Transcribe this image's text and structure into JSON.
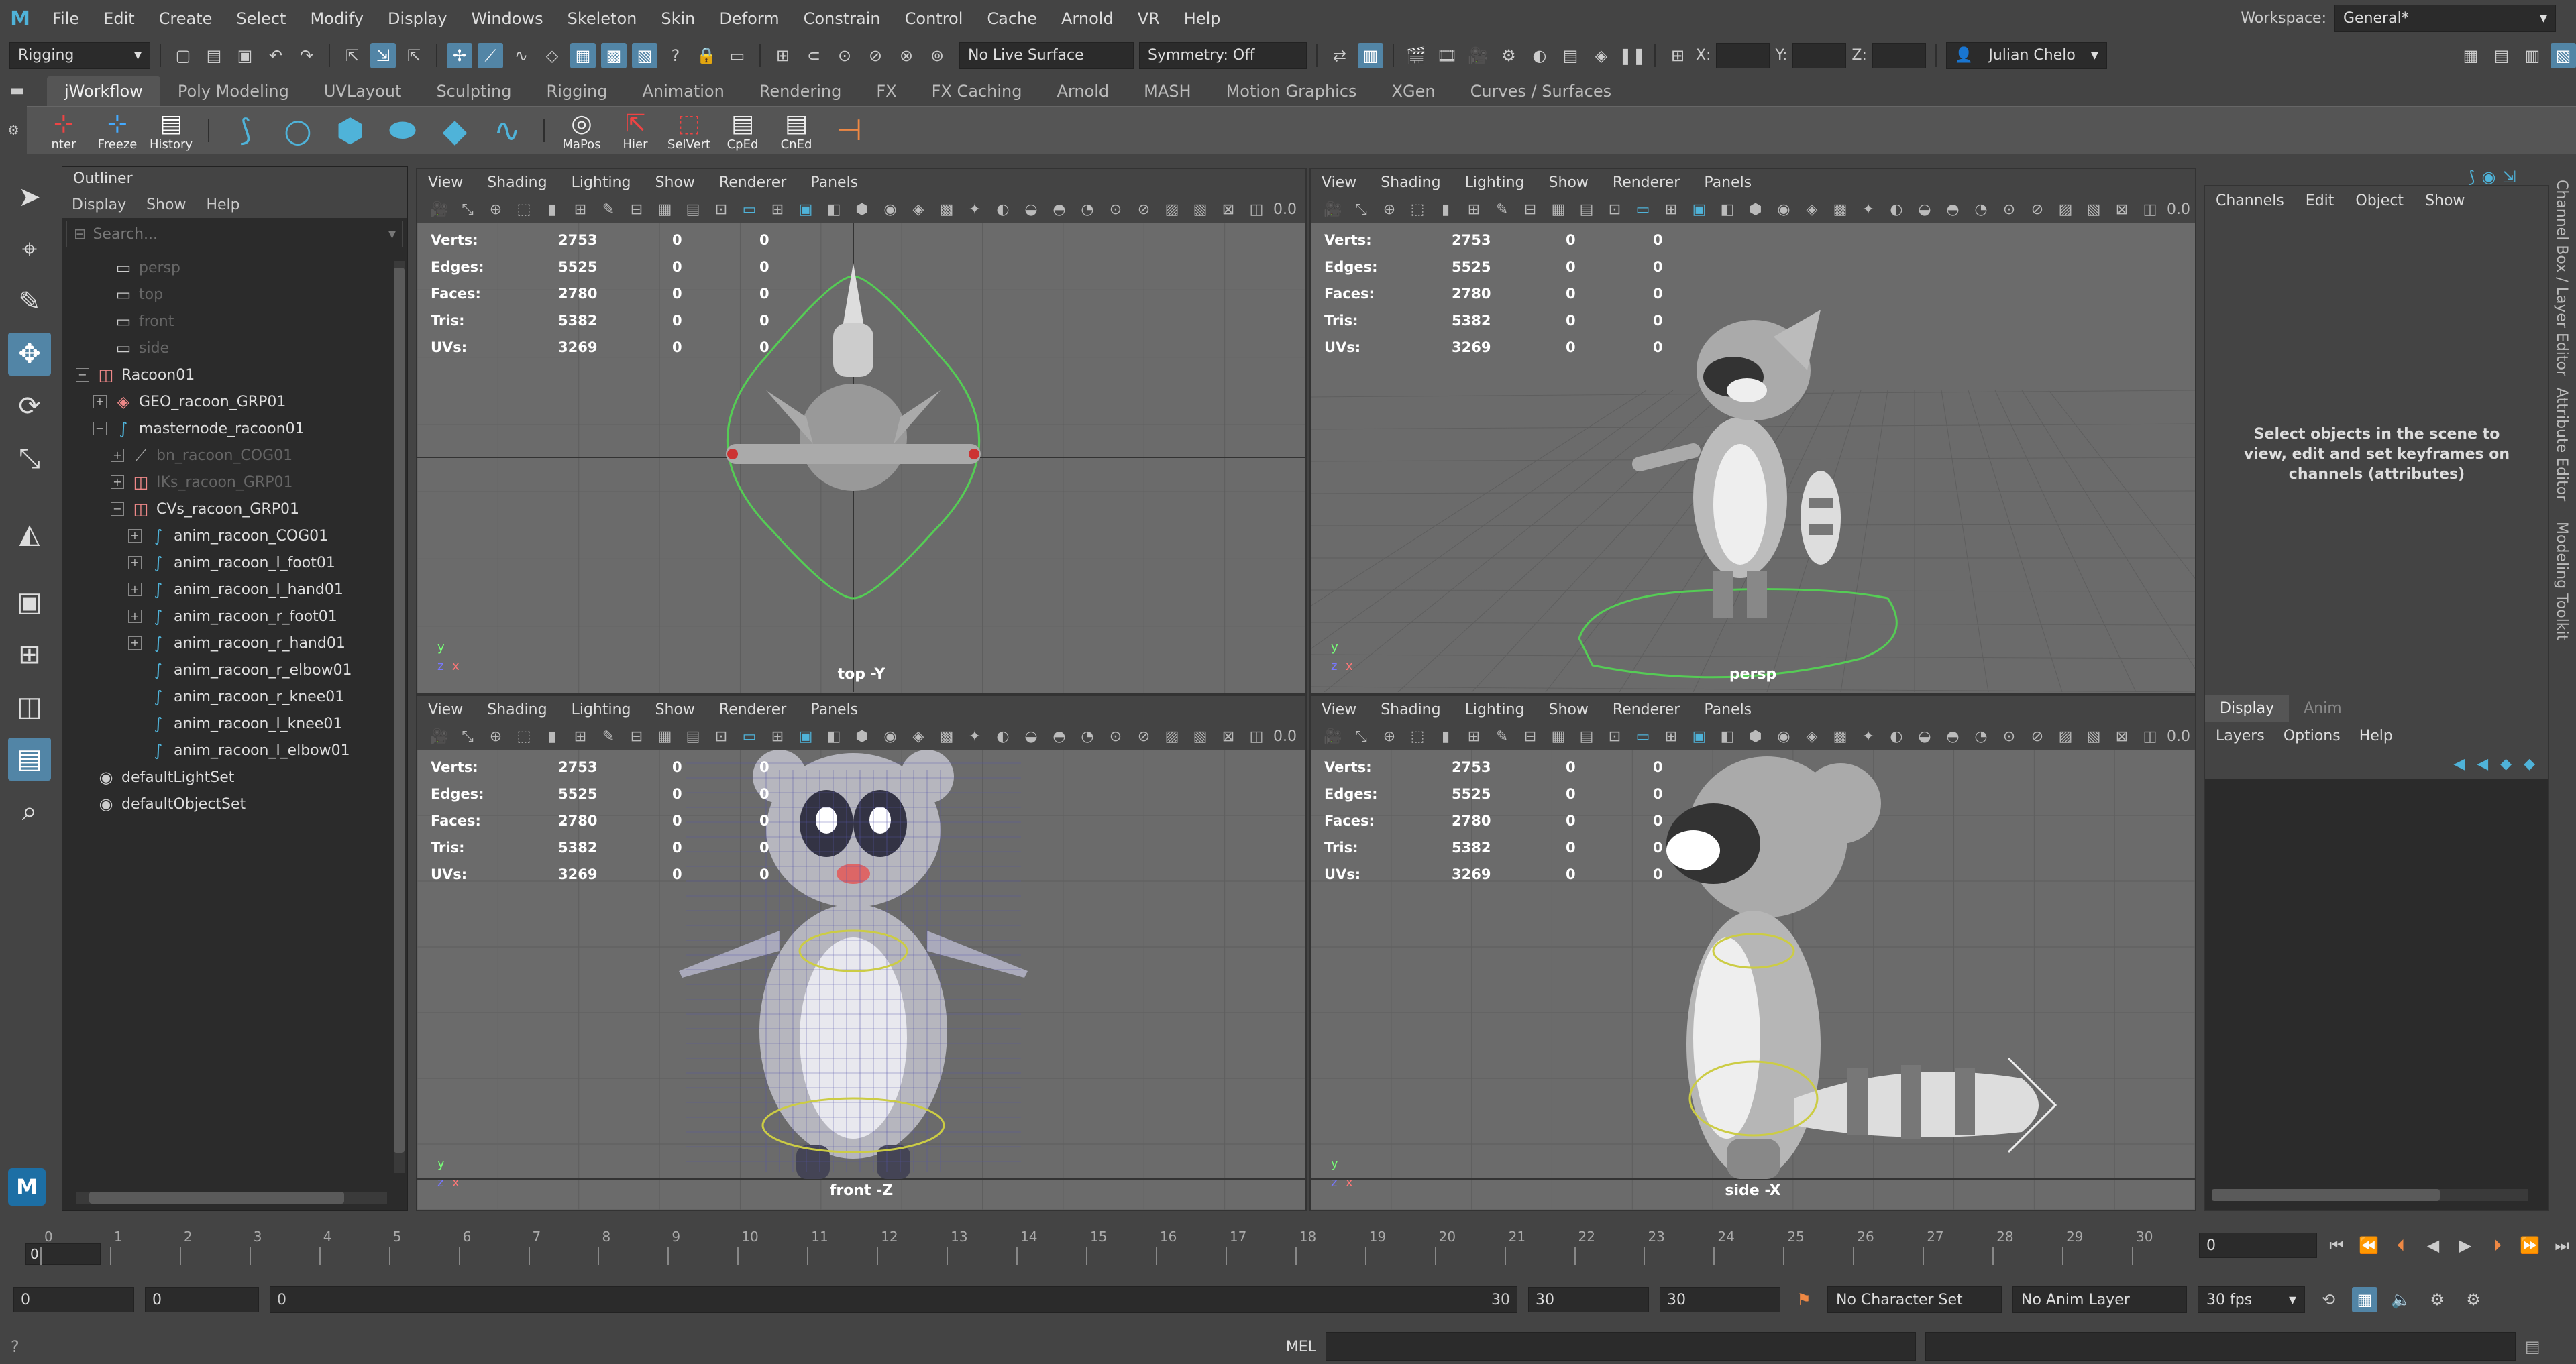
{
  "menubar": {
    "items": [
      "File",
      "Edit",
      "Create",
      "Select",
      "Modify",
      "Display",
      "Windows",
      "Skeleton",
      "Skin",
      "Deform",
      "Constrain",
      "Control",
      "Cache",
      "Arnold",
      "VR",
      "Help"
    ],
    "workspace_label": "Workspace:",
    "workspace_value": "General*"
  },
  "statusline": {
    "menuset": "Rigging",
    "live_surface": "No Live Surface",
    "symmetry": "Symmetry: Off",
    "x_label": "X:",
    "y_label": "Y:",
    "z_label": "Z:",
    "user": "Julian Chelo"
  },
  "shelf": {
    "tabs": [
      "jWorkflow",
      "Poly Modeling",
      "UVLayout",
      "Sculpting",
      "Rigging",
      "Animation",
      "Rendering",
      "FX",
      "FX Caching",
      "Arnold",
      "MASH",
      "Motion Graphics",
      "XGen",
      "Curves / Surfaces"
    ],
    "buttons": [
      "nter",
      "Freeze",
      "History"
    ],
    "buttons2": [
      "MaPos",
      "Hier",
      "SelVert",
      "CpEd",
      "CnEd"
    ]
  },
  "outliner": {
    "title": "Outliner",
    "menu": [
      "Display",
      "Show",
      "Help"
    ],
    "search_placeholder": "Search...",
    "rows": [
      {
        "label": "persp",
        "indent": 1,
        "dim": true,
        "icon": "camera-icon",
        "glyph": "▭"
      },
      {
        "label": "top",
        "indent": 1,
        "dim": true,
        "icon": "camera-icon",
        "glyph": "▭"
      },
      {
        "label": "front",
        "indent": 1,
        "dim": true,
        "icon": "camera-icon",
        "glyph": "▭"
      },
      {
        "label": "side",
        "indent": 1,
        "dim": true,
        "icon": "camera-icon",
        "glyph": "▭"
      },
      {
        "label": "Racoon01",
        "indent": 0,
        "exp": "−",
        "icon": "group-icon",
        "glyph": "◫"
      },
      {
        "label": "GEO_racoon_GRP01",
        "indent": 1,
        "exp": "+",
        "icon": "group-icon",
        "glyph": "◈"
      },
      {
        "label": "masternode_racoon01",
        "indent": 1,
        "exp": "−",
        "icon": "curve-icon",
        "glyph": "∫"
      },
      {
        "label": "bn_racoon_COG01",
        "indent": 2,
        "exp": "+",
        "dim": true,
        "icon": "joint-icon",
        "glyph": "⟋"
      },
      {
        "label": "IKs_racoon_GRP01",
        "indent": 2,
        "exp": "+",
        "dim": true,
        "icon": "group-icon",
        "glyph": "◫"
      },
      {
        "label": "CVs_racoon_GRP01",
        "indent": 2,
        "exp": "−",
        "icon": "group-icon",
        "glyph": "◫"
      },
      {
        "label": "anim_racoon_COG01",
        "indent": 3,
        "exp": "+",
        "icon": "curve-icon",
        "glyph": "∫"
      },
      {
        "label": "anim_racoon_l_foot01",
        "indent": 3,
        "exp": "+",
        "icon": "curve-icon",
        "glyph": "∫"
      },
      {
        "label": "anim_racoon_l_hand01",
        "indent": 3,
        "exp": "+",
        "icon": "curve-icon",
        "glyph": "∫"
      },
      {
        "label": "anim_racoon_r_foot01",
        "indent": 3,
        "exp": "+",
        "icon": "curve-icon",
        "glyph": "∫"
      },
      {
        "label": "anim_racoon_r_hand01",
        "indent": 3,
        "exp": "+",
        "icon": "curve-icon",
        "glyph": "∫"
      },
      {
        "label": "anim_racoon_r_elbow01",
        "indent": 3,
        "icon": "curve-icon",
        "glyph": "∫"
      },
      {
        "label": "anim_racoon_r_knee01",
        "indent": 3,
        "icon": "curve-icon",
        "glyph": "∫"
      },
      {
        "label": "anim_racoon_l_knee01",
        "indent": 3,
        "icon": "curve-icon",
        "glyph": "∫"
      },
      {
        "label": "anim_racoon_l_elbow01",
        "indent": 3,
        "icon": "curve-icon",
        "glyph": "∫"
      },
      {
        "label": "defaultLightSet",
        "indent": 0,
        "icon": "set-icon",
        "glyph": "◉"
      },
      {
        "label": "defaultObjectSet",
        "indent": 0,
        "icon": "set-icon",
        "glyph": "◉"
      }
    ]
  },
  "viewport": {
    "menu": [
      "View",
      "Shading",
      "Lighting",
      "Show",
      "Renderer",
      "Panels"
    ],
    "value_field": "0.0",
    "hud": [
      [
        "Verts:",
        "2753",
        "0",
        "0"
      ],
      [
        "Edges:",
        "5525",
        "0",
        "0"
      ],
      [
        "Faces:",
        "2780",
        "0",
        "0"
      ],
      [
        "Tris:",
        "5382",
        "0",
        "0"
      ],
      [
        "UVs:",
        "3269",
        "0",
        "0"
      ]
    ],
    "labels": {
      "top": "top -Y",
      "persp": "persp",
      "front": "front -Z",
      "side": "side -X"
    },
    "axis_y": "y",
    "axis_x": "x",
    "axis_z": "z"
  },
  "channelbox": {
    "menu": [
      "Channels",
      "Edit",
      "Object",
      "Show"
    ],
    "message": "Select objects in the scene to view, edit and set keyframes on channels (attributes)",
    "side_tabs": [
      "Channel Box / Layer Editor",
      "Attribute Editor",
      "Modeling Toolkit"
    ]
  },
  "layereditor": {
    "tabs": [
      "Display",
      "Anim"
    ],
    "menu": [
      "Layers",
      "Options",
      "Help"
    ]
  },
  "timeline": {
    "ticks": [
      "0",
      "1",
      "2",
      "3",
      "4",
      "5",
      "6",
      "7",
      "8",
      "9",
      "10",
      "11",
      "12",
      "13",
      "14",
      "15",
      "16",
      "17",
      "18",
      "19",
      "20",
      "21",
      "22",
      "23",
      "24",
      "25",
      "26",
      "27",
      "28",
      "29",
      "30"
    ],
    "current_frame": "0",
    "current_field": "0"
  },
  "range": {
    "start": "0",
    "start2": "0",
    "slider_left": "0",
    "slider_right": "30",
    "end": "30",
    "end2": "30",
    "character_set": "No Character Set",
    "anim_layer": "No Anim Layer",
    "fps": "30 fps"
  },
  "cmdline": {
    "label": "MEL"
  },
  "colors": {
    "accent": "#5285a6",
    "viewport_bg": "#6b6b6b",
    "panel_bg": "#444444",
    "dark_bg": "#2b2b2b"
  }
}
